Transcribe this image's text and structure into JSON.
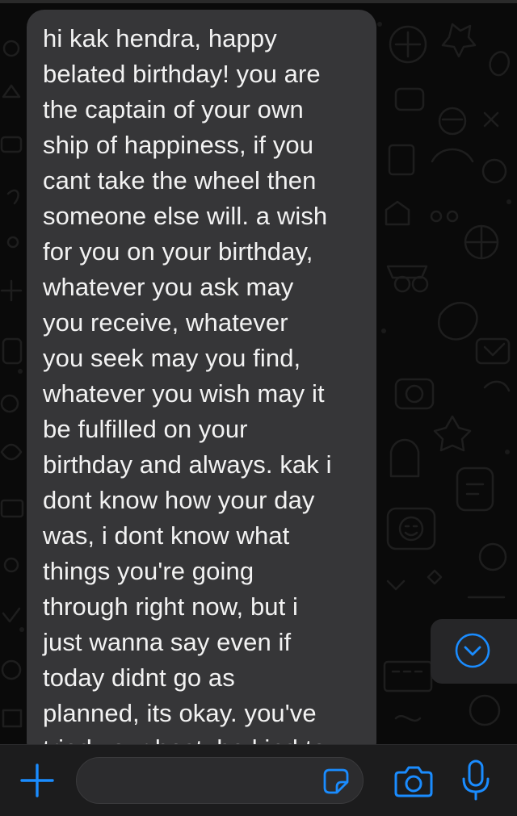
{
  "message": {
    "text": "hi kak hendra, happy\nbelated birthday! you are\nthe captain of your own\nship of happiness, if you\ncant take the wheel then\nsomeone else will. a wish\nfor you on your birthday,\nwhatever you ask may\nyou receive, whatever\nyou seek may you find,\nwhatever you wish may it\nbe fulfilled on your\nbirthday and always. kak i\ndont know how your day\nwas, i dont know what\nthings you're going\nthrough right now, but i\njust wanna say even if\ntoday didnt go as\nplanned, its okay. you've\ntried your best, be kind to",
    "bubble_color": "#363638",
    "text_color": "#f2f2f2"
  },
  "scroll_button": {
    "icon": "chevron-down-circle-icon"
  },
  "composer": {
    "placeholder": "",
    "attach_icon": "plus-icon",
    "sticker_icon": "sticker-icon",
    "camera_icon": "camera-icon",
    "mic_icon": "microphone-icon",
    "accent_color": "#1a8cff"
  }
}
